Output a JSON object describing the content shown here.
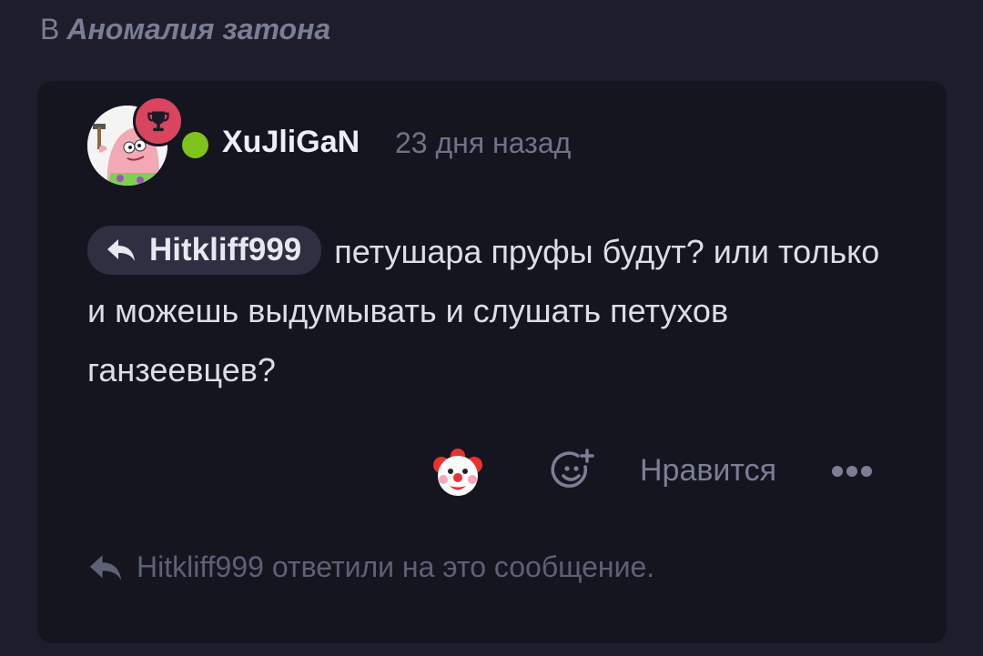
{
  "context": {
    "prefix": "В",
    "channel": "Аномалия затона"
  },
  "comment": {
    "author": "XuJliGaN",
    "status": "online",
    "badge_icon": "trophy-icon",
    "timestamp": "23 дня назад",
    "reply_to": "Hitkliff999",
    "text": "петушара пруфы будут? или только и можешь выдумывать и слушать петухов ганзеевцев?"
  },
  "actions": {
    "reaction_emoji": "🤡",
    "add_reaction_icon": "add-emoji-icon",
    "like_label": "Нравится",
    "more_icon": "more-dots-icon"
  },
  "replies_note": "Hitkliff999 ответили на это сообщение.",
  "colors": {
    "background": "#1d1d2b",
    "card": "#151520",
    "badge": "#d9455e",
    "online": "#7ec21b",
    "chip": "#2e3041"
  }
}
